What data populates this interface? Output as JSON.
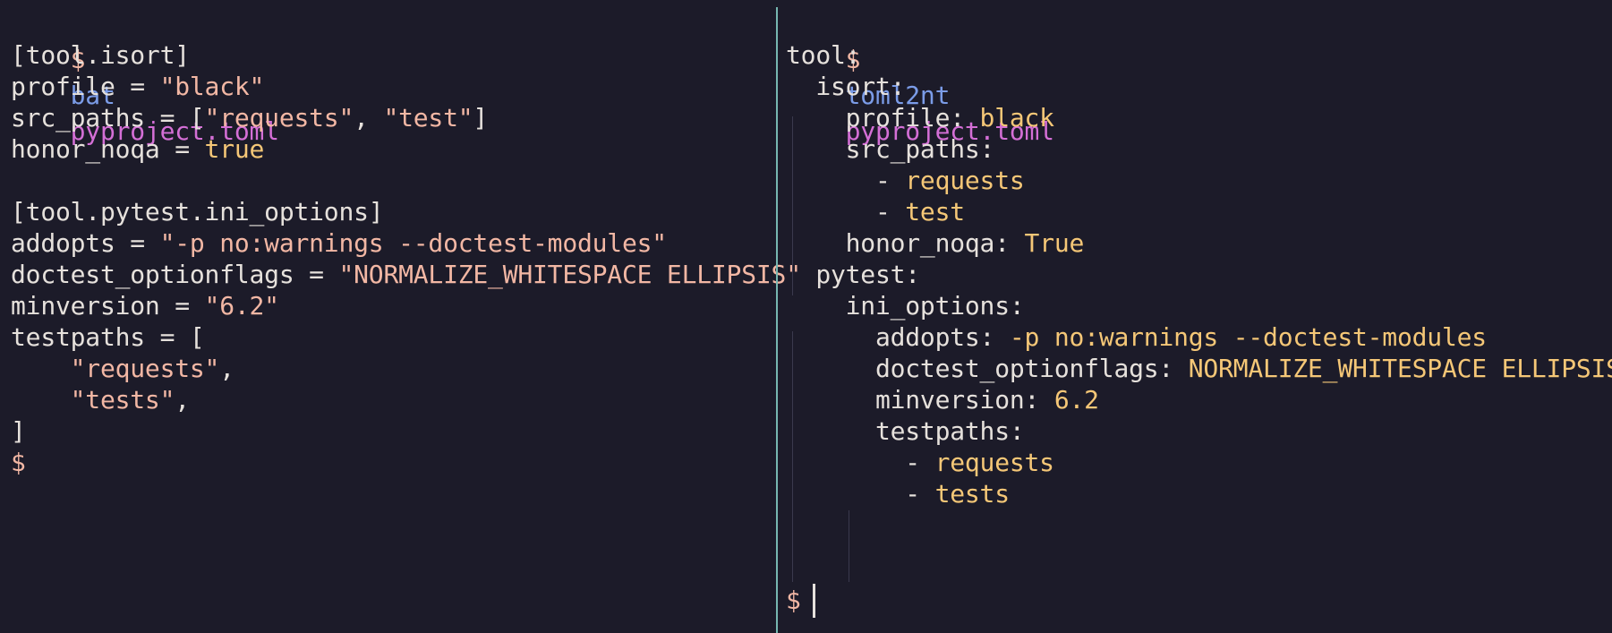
{
  "left_pane": {
    "prompt": "$",
    "command": "bat",
    "argument": "pyproject.toml",
    "lines": [
      {
        "parts": [
          {
            "t": "[tool.isort]",
            "c": "plain"
          }
        ]
      },
      {
        "parts": [
          {
            "t": "profile = ",
            "c": "plain"
          },
          {
            "t": "\"black\"",
            "c": "str"
          }
        ]
      },
      {
        "parts": [
          {
            "t": "src_paths = [",
            "c": "plain"
          },
          {
            "t": "\"requests\"",
            "c": "str"
          },
          {
            "t": ", ",
            "c": "plain"
          },
          {
            "t": "\"test\"",
            "c": "str"
          },
          {
            "t": "]",
            "c": "plain"
          }
        ]
      },
      {
        "parts": [
          {
            "t": "honor_noqa = ",
            "c": "plain"
          },
          {
            "t": "true",
            "c": "val"
          }
        ]
      },
      {
        "parts": [
          {
            "t": "",
            "c": "plain"
          }
        ]
      },
      {
        "parts": [
          {
            "t": "[tool.pytest.ini_options]",
            "c": "plain"
          }
        ]
      },
      {
        "parts": [
          {
            "t": "addopts = ",
            "c": "plain"
          },
          {
            "t": "\"-p no:warnings --doctest-modules\"",
            "c": "str"
          }
        ]
      },
      {
        "parts": [
          {
            "t": "doctest_optionflags = ",
            "c": "plain"
          },
          {
            "t": "\"NORMALIZE_WHITESPACE ELLIPSIS\"",
            "c": "str"
          }
        ]
      },
      {
        "parts": [
          {
            "t": "minversion = ",
            "c": "plain"
          },
          {
            "t": "\"6.2\"",
            "c": "str"
          }
        ]
      },
      {
        "parts": [
          {
            "t": "testpaths = [",
            "c": "plain"
          }
        ]
      },
      {
        "parts": [
          {
            "t": "    ",
            "c": "plain"
          },
          {
            "t": "\"requests\"",
            "c": "str"
          },
          {
            "t": ",",
            "c": "plain"
          }
        ]
      },
      {
        "parts": [
          {
            "t": "    ",
            "c": "plain"
          },
          {
            "t": "\"tests\"",
            "c": "str"
          },
          {
            "t": ",",
            "c": "plain"
          }
        ]
      },
      {
        "parts": [
          {
            "t": "]",
            "c": "plain"
          }
        ]
      }
    ],
    "end_prompt": "$"
  },
  "right_pane": {
    "prompt": "$",
    "command": "toml2nt",
    "argument": "pyproject.toml",
    "lines": [
      {
        "parts": [
          {
            "t": "tool:",
            "c": "plain"
          }
        ]
      },
      {
        "parts": [
          {
            "t": "  isort:",
            "c": "plain"
          }
        ]
      },
      {
        "parts": [
          {
            "t": "    profile: ",
            "c": "plain"
          },
          {
            "t": "black",
            "c": "val"
          }
        ]
      },
      {
        "parts": [
          {
            "t": "    src_paths:",
            "c": "plain"
          }
        ]
      },
      {
        "parts": [
          {
            "t": "      - ",
            "c": "plain"
          },
          {
            "t": "requests",
            "c": "val"
          }
        ]
      },
      {
        "parts": [
          {
            "t": "      - ",
            "c": "plain"
          },
          {
            "t": "test",
            "c": "val"
          }
        ]
      },
      {
        "parts": [
          {
            "t": "    honor_noqa: ",
            "c": "plain"
          },
          {
            "t": "True",
            "c": "val"
          }
        ]
      },
      {
        "parts": [
          {
            "t": "  pytest:",
            "c": "plain"
          }
        ]
      },
      {
        "parts": [
          {
            "t": "    ini_options:",
            "c": "plain"
          }
        ]
      },
      {
        "parts": [
          {
            "t": "      addopts: ",
            "c": "plain"
          },
          {
            "t": "-p no:warnings --doctest-modules",
            "c": "val"
          }
        ]
      },
      {
        "parts": [
          {
            "t": "      doctest_optionflags: ",
            "c": "plain"
          },
          {
            "t": "NORMALIZE_WHITESPACE ELLIPSIS",
            "c": "val"
          }
        ]
      },
      {
        "parts": [
          {
            "t": "      minversion: ",
            "c": "plain"
          },
          {
            "t": "6.2",
            "c": "val"
          }
        ]
      },
      {
        "parts": [
          {
            "t": "      testpaths:",
            "c": "plain"
          }
        ]
      },
      {
        "parts": [
          {
            "t": "        - ",
            "c": "plain"
          },
          {
            "t": "requests",
            "c": "val"
          }
        ]
      },
      {
        "parts": [
          {
            "t": "        - ",
            "c": "plain"
          },
          {
            "t": "tests",
            "c": "val"
          }
        ]
      }
    ],
    "end_prompt": "$"
  },
  "colors": {
    "background": "#1c1b29",
    "prompt": "#f2b7a4",
    "command": "#7b9ce8",
    "argument": "#d46fd6",
    "string": "#f2b7a4",
    "value": "#f5c777",
    "text": "#e6e1dc",
    "divider": "#77b7b1"
  }
}
